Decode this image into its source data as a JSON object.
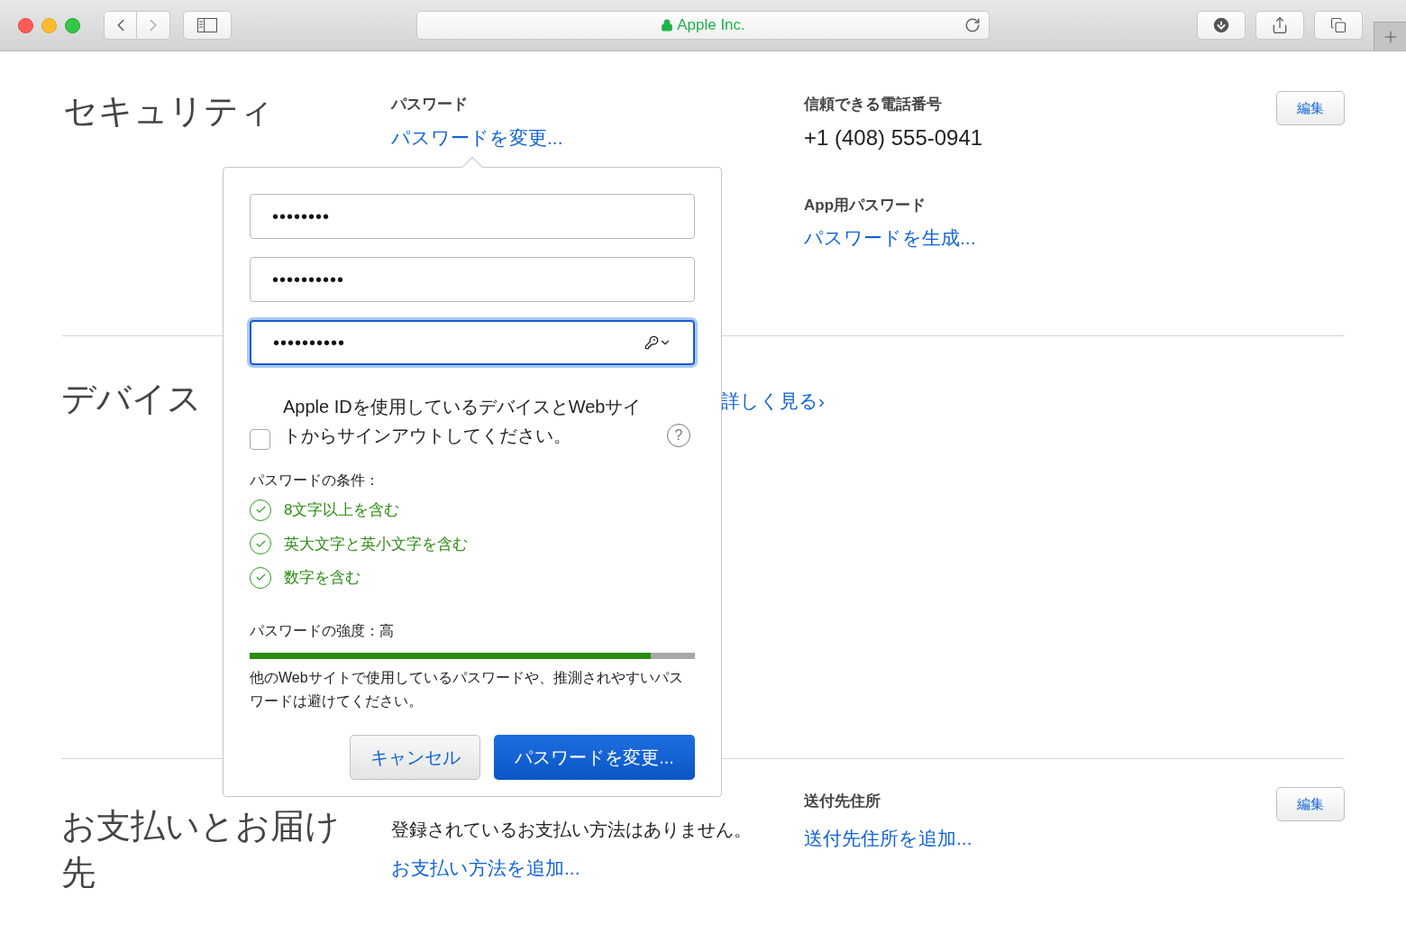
{
  "browser": {
    "address": "Apple Inc."
  },
  "security": {
    "heading": "セキュリティ",
    "password_label": "パスワード",
    "password_link": "パスワードを変更...",
    "phone_label": "信頼できる電話番号",
    "phone": "+1 (408) 555-0941",
    "app_password_label": "App用パスワード",
    "app_password_link": "パスワードを生成...",
    "edit_button": "編集"
  },
  "devices": {
    "heading": "デバイス",
    "more_link": "詳しく見る›"
  },
  "payment": {
    "heading": "お支払いとお届け先",
    "message": "登録されているお支払い方法はありません。",
    "add_payment_link": "お支払い方法を追加...",
    "shipping_label": "送付先住所",
    "shipping_link": "送付先住所を追加...",
    "edit_button": "編集"
  },
  "popover": {
    "fields": [
      {
        "value": "••••••••",
        "focused": false
      },
      {
        "value": "••••••••••",
        "focused": false
      },
      {
        "value": "••••••••••",
        "focused": true
      }
    ],
    "signout": {
      "checked": false,
      "text": "Apple IDを使用しているデバイスとWebサイトからサインアウトしてください。",
      "help": "?"
    },
    "requirements_title": "パスワードの条件：",
    "requirements": [
      {
        "text": "8文字以上を含む",
        "met": true
      },
      {
        "text": "英大文字と英小文字を含む",
        "met": true
      },
      {
        "text": "数字を含む",
        "met": true
      }
    ],
    "strength_label": "パスワードの強度：",
    "strength_value": "高",
    "strength": {
      "level": 0.9
    },
    "advice": "他のWebサイトで使用しているパスワードや、推測されやすいパスワードは避けてください。",
    "cancel_button": "キャンセル",
    "submit_button": "パスワードを変更..."
  }
}
